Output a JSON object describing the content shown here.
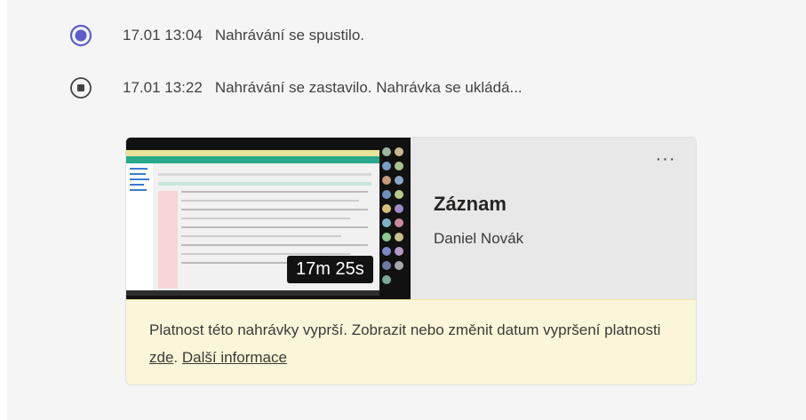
{
  "events": [
    {
      "time": "17.01 13:04",
      "text": "Nahrávání se spustilo.",
      "icon": "recording-started-icon",
      "color": "#5b5fc7"
    },
    {
      "time": "17.01 13:22",
      "text": "Nahrávání se zastavilo. Nahrávka se ukládá...",
      "icon": "recording-stopped-icon",
      "color": "#424242"
    }
  ],
  "recording": {
    "duration": "17m 25s",
    "title": "Záznam",
    "owner": "Daniel Novák",
    "more_label": "···"
  },
  "notice": {
    "text_before": "Platnost této nahrávky vyprší. Zobrazit nebo změnit datum vypršení platnosti ",
    "link_here": "zde",
    "separator": ". ",
    "link_more": "Další informace"
  }
}
